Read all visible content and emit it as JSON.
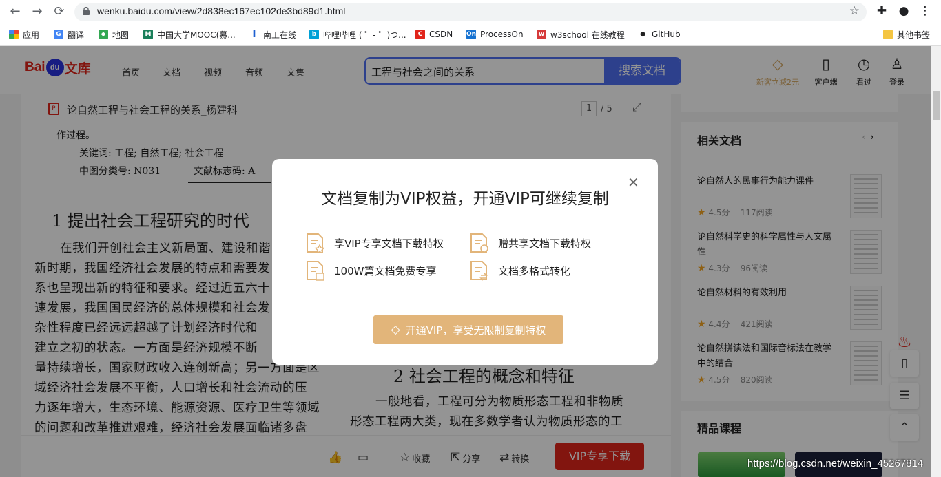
{
  "browser": {
    "url": "wenku.baidu.com/view/2d838ec167ec102de3bd89d1.html",
    "bookmarks": [
      {
        "label": "应用",
        "color": "#e94235"
      },
      {
        "label": "翻译",
        "color": "#4285f4"
      },
      {
        "label": "地图",
        "color": "#34a853"
      },
      {
        "label": "中国大学MOOC(慕...",
        "color": "#1a7f5a"
      },
      {
        "label": "南工在线",
        "color": "#1e5fd0"
      },
      {
        "label": "哔哩哔哩 ( ゜- ゜)つ...",
        "color": "#00a1d6"
      },
      {
        "label": "CSDN",
        "color": "#e1251b"
      },
      {
        "label": "ProcessOn",
        "color": "#1672d1"
      },
      {
        "label": "w3school 在线教程",
        "color": "#d63a3a"
      },
      {
        "label": "GitHub",
        "color": "#ffffff"
      }
    ],
    "other_bookmarks": "其他书签"
  },
  "header": {
    "logo_bai": "Bai",
    "logo_du": "du",
    "logo_wenku": "文库",
    "nav": [
      "首页",
      "文档",
      "视频",
      "音频",
      "文集"
    ],
    "search_value": "工程与社会之间的关系",
    "search_button": "搜索文档",
    "promo": "新客立减2元",
    "client": "客户端",
    "history": "看过",
    "login": "登录"
  },
  "doc": {
    "title": "论自然工程与社会工程的关系_杨建科",
    "page_current": "1",
    "page_total": "/ 5",
    "top_line": "作过程。",
    "keywords": "关键词: 工程; 自然工程; 社会工程",
    "clc": "中图分类号: N031",
    "doc_code": "文献标志码: A",
    "heading1": "1   提出社会工程研究的时代",
    "left_lines": [
      "在我们开创社会主义新局面、建设和谐",
      "新时期，我国经济社会发展的特点和需要发",
      "系也呈现出新的特征和要求。经过近五六十",
      "速发展，我国国民经济的总体规模和社会发",
      "杂性程度已经远远超越了计划经济时代和",
      "建立之初的状态。一方面是经济规模不断",
      "量持续增长，国家财政收入连创新高；另一方面是区",
      "域经济社会发展不平衡，人口增长和社会流动的压",
      "力逐年增大，生态环境、能源资源、医疗卫生等领域",
      "的问题和改革推进艰难，经济社会发展面临诸多盘"
    ],
    "heading2": "2   社会工程的概念和特征",
    "right_lines": [
      "一般地看，工程可分为物质形态工程和非物质",
      "形态工程两大类，现在多数学者认为物质形态的工"
    ]
  },
  "sidebar": {
    "related_title": "相关文档",
    "related": [
      {
        "title": "论自然人的民事行为能力课件",
        "rating": "4.5分",
        "reads": "117阅读"
      },
      {
        "title": "论自然科学史的科学属性与人文属性",
        "rating": "4.3分",
        "reads": "96阅读"
      },
      {
        "title": "论自然材料的有效利用",
        "rating": "4.4分",
        "reads": "421阅读"
      },
      {
        "title": "论自然拼读法和国际音标法在教学中的结合",
        "rating": "4.5分",
        "reads": "820阅读"
      }
    ],
    "courses_title": "精品课程"
  },
  "bottom": {
    "favorite": "收藏",
    "share": "分享",
    "convert": "转换",
    "vip_download": "VIP专享下载"
  },
  "modal": {
    "title": "文档复制为VIP权益，开通VIP可继续复制",
    "benefits": [
      "享VIP专享文档下载特权",
      "赠共享文档下载特权",
      "100W篇文档免费专享",
      "文档多格式转化"
    ],
    "cta": "开通VIP，享受无限制复制特权"
  },
  "watermark": "https://blog.csdn.net/weixin_45267814"
}
